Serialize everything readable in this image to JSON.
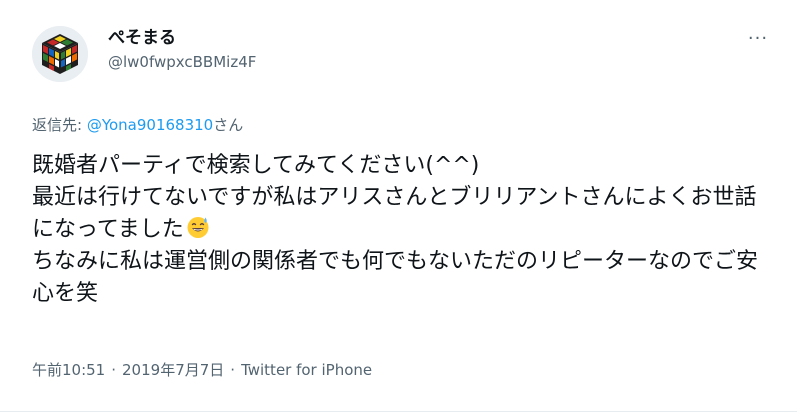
{
  "user": {
    "display_name": "ぺそまる",
    "handle": "@lw0fwpxcBBMiz4F",
    "avatar_icon": "rubiks-cube-icon"
  },
  "menu": {
    "more_label": "···",
    "more_icon": "more-dots-icon"
  },
  "reply": {
    "prefix": "返信先: ",
    "mention": "@Yona90168310",
    "suffix": "さん"
  },
  "tweet": {
    "text_part1": "既婚者パーティで検索してみてください(^^)\n最近は行けてないですが私はアリスさんとブリリアントさんによくお世話になってました",
    "emoji_icon": "grinning-sweat-emoji-icon",
    "text_part2": "\nちなみに私は運営側の関係者でも何でもないただのリピーターなのでご安心を笑"
  },
  "meta": {
    "time": "午前10:51",
    "separator": "·",
    "date": "2019年7月7日",
    "source": "Twitter for iPhone"
  },
  "colors": {
    "link": "#1d9bf0",
    "secondary": "#536471",
    "primary_text": "#0f1419"
  }
}
